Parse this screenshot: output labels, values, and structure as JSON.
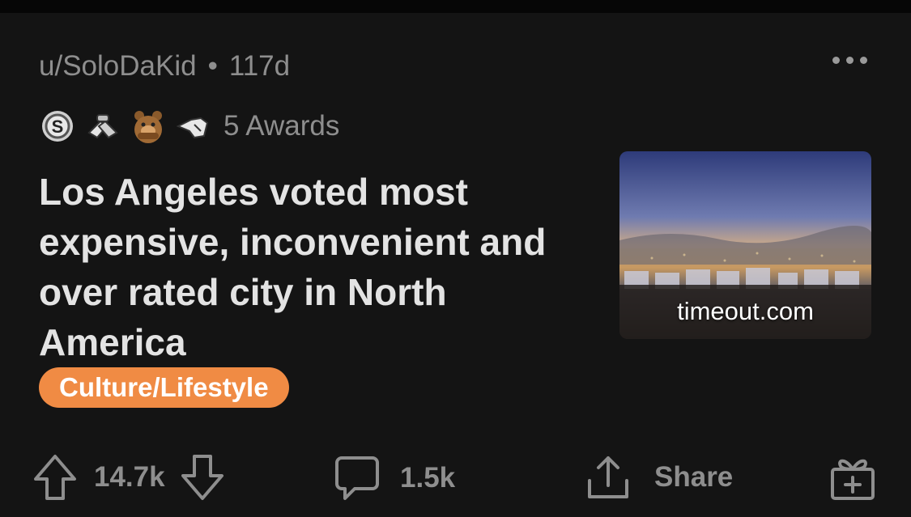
{
  "post": {
    "username": "u/SoloDaKid",
    "separator": "•",
    "age": "117d",
    "awards": {
      "icons": [
        "silver-award-icon",
        "helpful-hands-award-icon",
        "bear-award-icon",
        "pointing-hand-award-icon"
      ],
      "count_label": "5 Awards"
    },
    "title": "Los Angeles voted most expensive, inconvenient and over rated city in North America",
    "flair": {
      "label": "Culture/Lifestyle",
      "color": "#f08b44"
    },
    "link": {
      "domain": "timeout.com"
    }
  },
  "actions": {
    "score": "14.7k",
    "comments": "1.5k",
    "share_label": "Share"
  }
}
